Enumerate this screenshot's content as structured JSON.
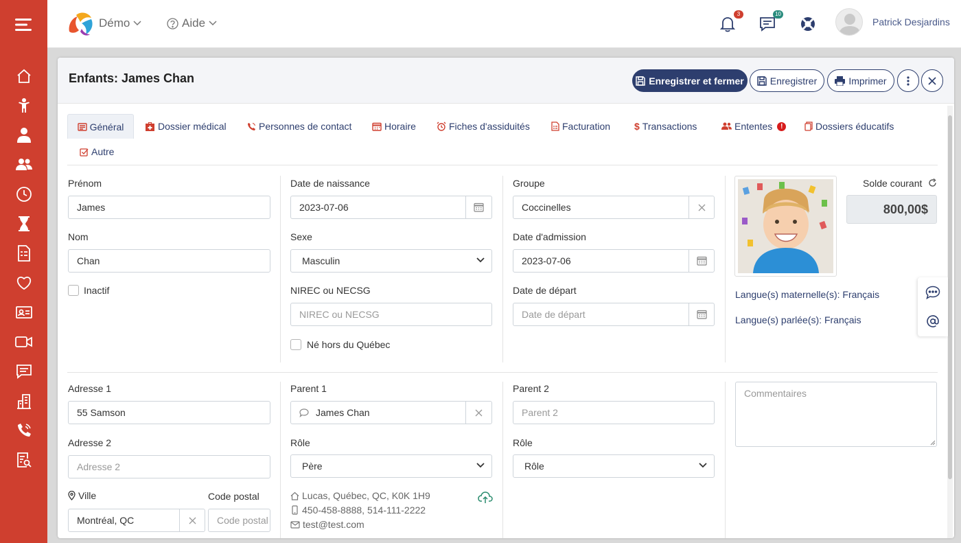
{
  "header": {
    "demo_label": "Démo",
    "help_label": "Aide",
    "notifications_count": "3",
    "messages_count": "10",
    "user_name": "Patrick Desjardins"
  },
  "modal": {
    "title": "Enfants: James Chan",
    "buttons": {
      "save_close": "Enregistrer et fermer",
      "save": "Enregistrer",
      "print": "Imprimer"
    }
  },
  "tabs": [
    {
      "label": "Général",
      "icon": "general-icon"
    },
    {
      "label": "Dossier médical",
      "icon": "medical-kit-icon"
    },
    {
      "label": "Personnes de contact",
      "icon": "phone-icon"
    },
    {
      "label": "Horaire",
      "icon": "calendar-icon"
    },
    {
      "label": "Fiches d'assiduités",
      "icon": "alarm-clock-icon"
    },
    {
      "label": "Facturation",
      "icon": "invoice-icon"
    },
    {
      "label": "Transactions",
      "icon": "dollar-icon"
    },
    {
      "label": "Ententes",
      "icon": "users-icon",
      "alert": "!"
    },
    {
      "label": "Dossiers éducatifs",
      "icon": "document-icon"
    },
    {
      "label": "Autre",
      "icon": "checkbox-icon"
    }
  ],
  "form": {
    "first_name": {
      "label": "Prénom",
      "value": "James"
    },
    "last_name": {
      "label": "Nom",
      "value": "Chan"
    },
    "inactive": {
      "label": "Inactif"
    },
    "birth_date": {
      "label": "Date de naissance",
      "value": "2023-07-06"
    },
    "sex": {
      "label": "Sexe",
      "value": "Masculin"
    },
    "nirec": {
      "label": "NIREC ou NECSG",
      "placeholder": "NIREC ou NECSG"
    },
    "born_outside": {
      "label": "Né hors du Québec"
    },
    "group": {
      "label": "Groupe",
      "value": "Coccinelles"
    },
    "admission_date": {
      "label": "Date d'admission",
      "value": "2023-07-06"
    },
    "departure_date": {
      "label": "Date de départ",
      "placeholder": "Date de départ"
    },
    "balance": {
      "label": "Solde courant",
      "value": "800,00$"
    },
    "languages_maternal": "Langue(s) maternelle(s): Français",
    "languages_spoken": "Langue(s) parlée(s): Français",
    "address1": {
      "label": "Adresse 1",
      "value": "55 Samson"
    },
    "address2": {
      "label": "Adresse 2",
      "placeholder": "Adresse 2"
    },
    "city": {
      "label": "Ville",
      "value": "Montréal, QC"
    },
    "postal_code": {
      "label": "Code postal",
      "placeholder": "Code postal"
    },
    "parent1": {
      "label": "Parent 1",
      "value": "James Chan"
    },
    "role1": {
      "label": "Rôle",
      "value": "Père"
    },
    "parent1_info": {
      "address": "Lucas, Québec, QC, K0K 1H9",
      "phones": "450-458-8888, 514-111-2222",
      "email": "test@test.com"
    },
    "parent2": {
      "label": "Parent 2",
      "placeholder": "Parent 2"
    },
    "role2": {
      "label": "Rôle",
      "value": "Rôle"
    },
    "comments": {
      "placeholder": "Commentaires"
    }
  }
}
